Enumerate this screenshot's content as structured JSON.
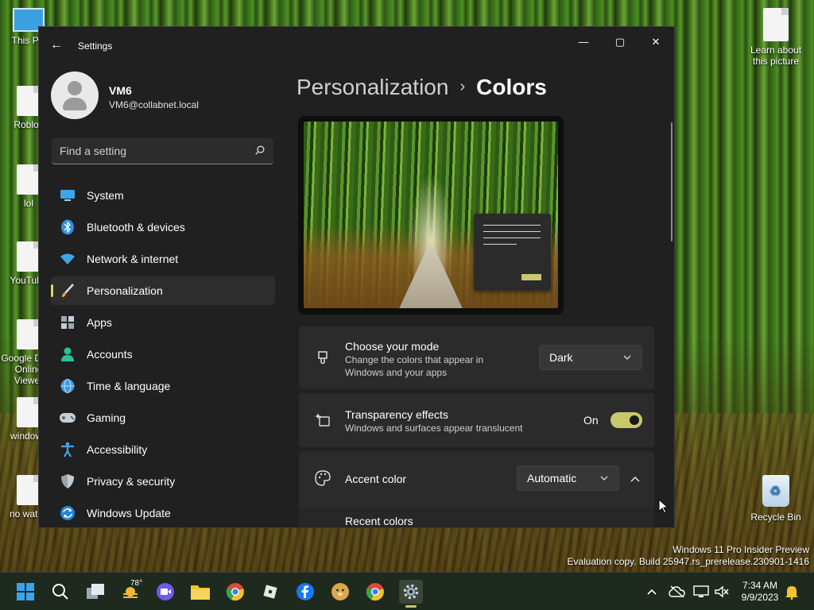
{
  "desktop": {
    "icons": [
      {
        "label": "This PC"
      },
      {
        "label": "Roblox"
      },
      {
        "label": "lol"
      },
      {
        "label": "YouTube"
      },
      {
        "label": "Google Docs Online Viewer"
      },
      {
        "label": "windows"
      },
      {
        "label": "no watch"
      },
      {
        "label": "Learn about this picture"
      },
      {
        "label": "Recycle Bin"
      }
    ],
    "watermark_line1": "Windows 11 Pro Insider Preview",
    "watermark_line2": "Evaluation copy. Build 25947.rs_prerelease.230901-1416"
  },
  "window": {
    "app_title": "Settings",
    "min_glyph": "—",
    "max_glyph": "▢",
    "close_glyph": "✕",
    "back_glyph": "←"
  },
  "profile": {
    "name": "VM6",
    "email": "VM6@collabnet.local"
  },
  "search": {
    "placeholder": "Find a setting"
  },
  "nav": {
    "items": [
      {
        "label": "System",
        "icon": "monitor-icon"
      },
      {
        "label": "Bluetooth & devices",
        "icon": "bluetooth-icon"
      },
      {
        "label": "Network & internet",
        "icon": "wifi-icon"
      },
      {
        "label": "Personalization",
        "icon": "brush-icon",
        "active": true
      },
      {
        "label": "Apps",
        "icon": "apps-icon"
      },
      {
        "label": "Accounts",
        "icon": "person-icon"
      },
      {
        "label": "Time & language",
        "icon": "globe-clock-icon"
      },
      {
        "label": "Gaming",
        "icon": "gamepad-icon"
      },
      {
        "label": "Accessibility",
        "icon": "accessibility-icon"
      },
      {
        "label": "Privacy & security",
        "icon": "shield-icon"
      },
      {
        "label": "Windows Update",
        "icon": "update-icon"
      }
    ]
  },
  "main": {
    "breadcrumb_parent": "Personalization",
    "breadcrumb_sep": "›",
    "breadcrumb_current": "Colors",
    "mode": {
      "title": "Choose your mode",
      "desc": "Change the colors that appear in Windows and your apps",
      "value": "Dark"
    },
    "transparency": {
      "title": "Transparency effects",
      "desc": "Windows and surfaces appear translucent",
      "state_label": "On",
      "on": true
    },
    "accent": {
      "title": "Accent color",
      "value": "Automatic",
      "recent_label": "Recent colors"
    },
    "accent_hex": "#c9c76a"
  },
  "taskbar": {
    "weather_temp": "78°",
    "time": "7:34 AM",
    "date": "9/9/2023"
  }
}
